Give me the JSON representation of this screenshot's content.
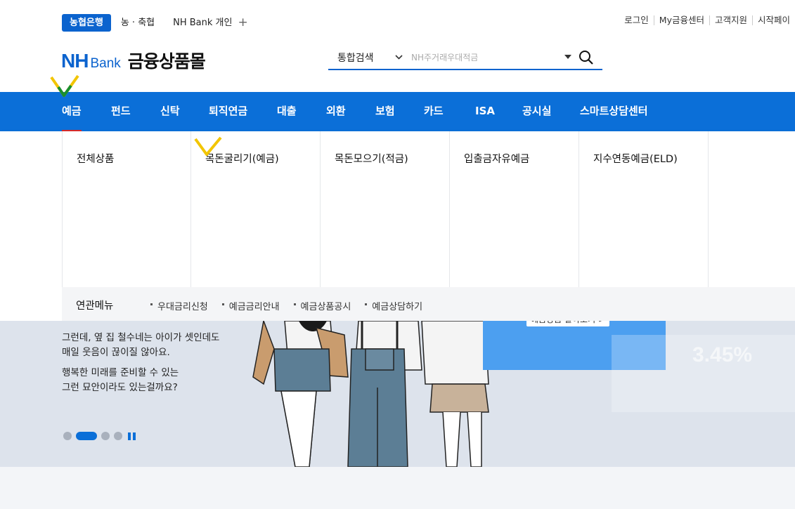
{
  "topbar": {
    "tab_active": "농협은행",
    "tab_2": "농 · 축협",
    "tab_3": "NH Bank 개인",
    "plus_icon": "plus-icon",
    "links": [
      "로그인",
      "My금융센터",
      "고객지원",
      "시작페이"
    ]
  },
  "header": {
    "logo_nh": "NH",
    "logo_bank": "Bank",
    "logo_mall": "금융상품몰",
    "search_category": "통합검색",
    "search_placeholder": "NH주거래우대적금"
  },
  "gnb": {
    "items": [
      "예금",
      "펀드",
      "신탁",
      "퇴직연금",
      "대출",
      "외환",
      "보험",
      "카드",
      "ISA",
      "공시실",
      "스마트상담센터"
    ]
  },
  "mega": {
    "columns": [
      "전체상품",
      "목돈굴리기(예금)",
      "목돈모으기(적금)",
      "입출금자유예금",
      "지수연동예금(ELD)"
    ],
    "related_title": "연관메뉴",
    "related_links": [
      "우대금리신청",
      "예금금리안내",
      "예금상품공시",
      "예금상담하기"
    ]
  },
  "banner": {
    "line1": "그런데, 옆 집 철수네는 아이가 셋인데도",
    "line2": "매일 웃음이 끊이질 않아요.",
    "line3": "행복한 미래를 준비할 수 있는",
    "line4": "그런 묘안이라도 있는걸까요?",
    "more_label": "예금상품 알아보기 >",
    "rate": "3.45%"
  },
  "colors": {
    "brand_blue": "#0b6fd8",
    "check_yellow": "#f2c500",
    "check_green": "#1a8f2e"
  }
}
